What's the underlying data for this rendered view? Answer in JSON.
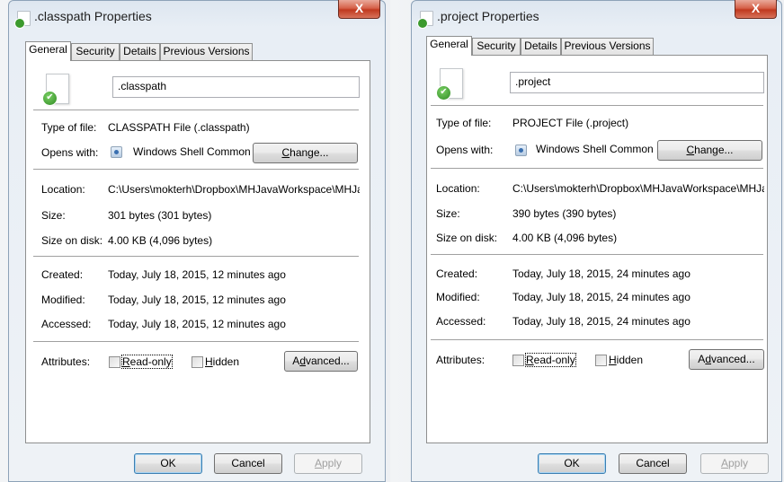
{
  "dialogs": [
    {
      "title": ".classpath Properties",
      "close_glyph": "X",
      "tabs": [
        "General",
        "Security",
        "Details",
        "Previous Versions"
      ],
      "filename": ".classpath",
      "labels": {
        "type_of_file": "Type of file:",
        "opens_with": "Opens with:",
        "location": "Location:",
        "size": "Size:",
        "size_on_disk": "Size on disk:",
        "created": "Created:",
        "modified": "Modified:",
        "accessed": "Accessed:",
        "attributes": "Attributes:"
      },
      "type_of_file": "CLASSPATH File (.classpath)",
      "opens_with": "Windows Shell Common",
      "change_button": {
        "pre": "",
        "ul": "C",
        "post": "hange..."
      },
      "location": "C:\\Users\\mokterh\\Dropbox\\MHJavaWorkspace\\MHJav",
      "size": "301 bytes (301 bytes)",
      "size_on_disk": "4.00 KB (4,096 bytes)",
      "created": "Today, July 18, 2015, 12 minutes ago",
      "modified": "Today, July 18, 2015, 12 minutes ago",
      "accessed": "Today, July 18, 2015, 12 minutes ago",
      "readonly": {
        "ul": "R",
        "post": "ead-only",
        "checked": false
      },
      "hidden": {
        "ul": "H",
        "post": "idden",
        "checked": false
      },
      "advanced_button": {
        "pre": "A",
        "ul": "d",
        "post": "vanced..."
      },
      "ok_button": "OK",
      "cancel_button": "Cancel",
      "apply_button": {
        "pre": "",
        "ul": "A",
        "post": "pply"
      },
      "opens_with_icon": "shell-app-icon",
      "file_icon": "document-with-check-icon"
    },
    {
      "title": ".project Properties",
      "close_glyph": "X",
      "tabs": [
        "General",
        "Security",
        "Details",
        "Previous Versions"
      ],
      "filename": ".project",
      "labels": {
        "type_of_file": "Type of file:",
        "opens_with": "Opens with:",
        "location": "Location:",
        "size": "Size:",
        "size_on_disk": "Size on disk:",
        "created": "Created:",
        "modified": "Modified:",
        "accessed": "Accessed:",
        "attributes": "Attributes:"
      },
      "type_of_file": "PROJECT File (.project)",
      "opens_with": "Windows Shell Common",
      "change_button": {
        "pre": "",
        "ul": "C",
        "post": "hange..."
      },
      "location": "C:\\Users\\mokterh\\Dropbox\\MHJavaWorkspace\\MHJav",
      "size": "390 bytes (390 bytes)",
      "size_on_disk": "4.00 KB (4,096 bytes)",
      "created": "Today, July 18, 2015, 24 minutes ago",
      "modified": "Today, July 18, 2015, 24 minutes ago",
      "accessed": "Today, July 18, 2015, 24 minutes ago",
      "readonly": {
        "ul": "R",
        "post": "ead-only",
        "checked": false
      },
      "hidden": {
        "ul": "H",
        "post": "idden",
        "checked": false
      },
      "advanced_button": {
        "pre": "A",
        "ul": "d",
        "post": "vanced..."
      },
      "ok_button": "OK",
      "cancel_button": "Cancel",
      "apply_button": {
        "pre": "",
        "ul": "A",
        "post": "pply"
      },
      "opens_with_icon": "shell-app-icon",
      "file_icon": "document-with-check-icon"
    }
  ],
  "colors": {
    "close_button": "#c7432a",
    "check_badge": "#3c9a2e",
    "default_button_border": "#3c7fb1"
  }
}
